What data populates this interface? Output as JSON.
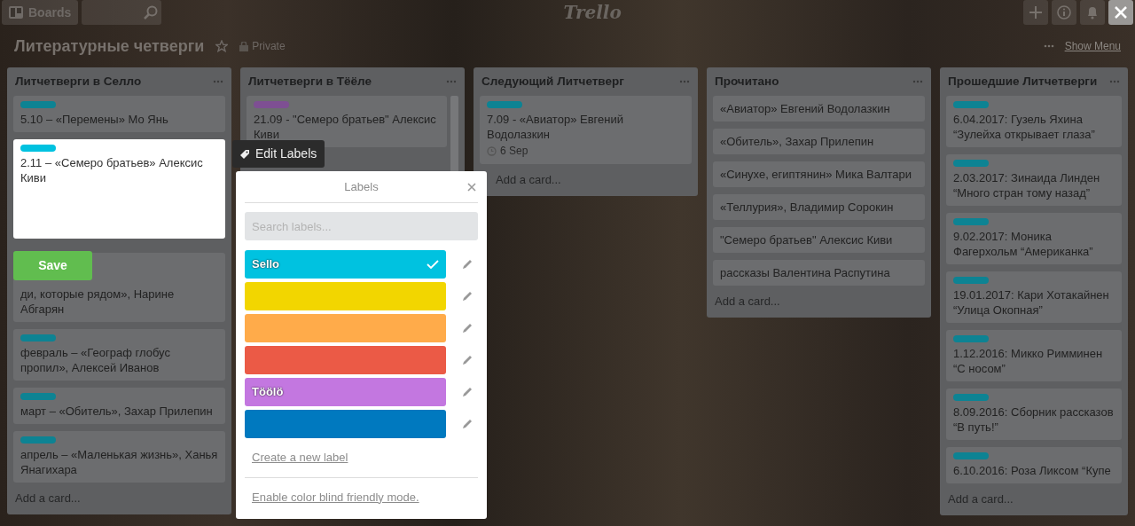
{
  "header": {
    "boards_button": "Boards",
    "logo": "Trello"
  },
  "board": {
    "title": "Литературные четверги",
    "visibility": "Private",
    "show_menu": "Show Menu"
  },
  "lists": [
    {
      "title": "Литчетверги в Селло",
      "cards": [
        {
          "kind": "card",
          "text": "5.10 – «Перемены» Мо Янь",
          "labels": [
            {
              "color": "#0d8393"
            }
          ]
        },
        {
          "kind": "quick_edit",
          "text": "2.11 – «Семеро братьев» Алексис Киви",
          "labels": [
            {
              "color": "#00c2e0"
            }
          ],
          "save": "Save"
        },
        {
          "kind": "covered",
          "text": "ди, которые рядом», Нарине Абгарян"
        },
        {
          "kind": "card",
          "text": "февраль – «Географ глобус пропил», Алексей Иванов",
          "labels": [
            {
              "color": "#0d8393"
            }
          ]
        },
        {
          "kind": "card",
          "text": "март – «Обитель», Захар Прилепин",
          "labels": [
            {
              "color": "#0d8393"
            }
          ]
        },
        {
          "kind": "card",
          "text": "апрель – «Маленькая жизнь», Ханья Янагихара",
          "labels": [
            {
              "color": "#0d8393"
            }
          ]
        }
      ],
      "add_card": "Add a card..."
    },
    {
      "title": "Литчетверги в Тёёле",
      "scrollbar": true,
      "cards": [
        {
          "kind": "card",
          "text": "21.09 - \"Семеро братьев\" Алексис Киви",
          "labels": [
            {
              "color": "#7e4f93"
            }
          ]
        }
      ]
    },
    {
      "title": "Следующий Литчетверг",
      "cards": [
        {
          "kind": "card",
          "text": "7.09 - «Авиатор» Евгений Водолазкин",
          "labels": [
            {
              "color": "#0d8393"
            }
          ],
          "due": "6 Sep"
        }
      ],
      "add_card": "Add a card..."
    },
    {
      "title": "Прочитано",
      "cards": [
        {
          "kind": "card",
          "text": "«Авиатор» Евгений Водолазкин"
        },
        {
          "kind": "card",
          "text": "«Обитель», Захар Прилепин"
        },
        {
          "kind": "card",
          "text": "«Синухе, египтянин» Мика Валтари"
        },
        {
          "kind": "card",
          "text": "«Теллурия», Владимир Сорокин"
        },
        {
          "kind": "card",
          "text": "\"Семеро братьев\" Алексис Киви"
        },
        {
          "kind": "card",
          "text": "рассказы Валентина Распутина"
        }
      ],
      "add_card": "Add a card..."
    },
    {
      "title": "Прошедшие Литчетверги",
      "cards": [
        {
          "kind": "card",
          "text": "6.04.2017: Гузель Яхина “Зулейха открывает глаза”",
          "labels": [
            {
              "color": "#0d8393"
            }
          ]
        },
        {
          "kind": "card",
          "text": "2.03.2017: Зинаида Линден “Много стран тому назад”",
          "labels": [
            {
              "color": "#0d8393"
            }
          ]
        },
        {
          "kind": "card",
          "text": "9.02.2017: Моника Фагерхольм “Американка”",
          "labels": [
            {
              "color": "#0d8393"
            }
          ]
        },
        {
          "kind": "card",
          "text": "19.01.2017: Кари Хотакайнен “Улица Окопная”",
          "labels": [
            {
              "color": "#0d8393"
            }
          ]
        },
        {
          "kind": "card",
          "text": "1.12.2016: Микко Римминен “С носом”",
          "labels": [
            {
              "color": "#0d8393"
            }
          ]
        },
        {
          "kind": "card",
          "text": "8.09.2016: Сборник рассказов “В путь!”",
          "labels": [
            {
              "color": "#0d8393"
            }
          ]
        },
        {
          "kind": "card",
          "text": "6.10.2016: Роза Ликсом “Купе",
          "labels": [
            {
              "color": "#0d8393"
            }
          ]
        }
      ],
      "add_card": "Add a card..."
    }
  ],
  "edit_labels_button": "Edit Labels",
  "labels_popup": {
    "title": "Labels",
    "search_placeholder": "Search labels...",
    "labels": [
      {
        "name": "Sello",
        "color": "#00c2e0",
        "selected": true
      },
      {
        "color": "#f2d600",
        "selected": false
      },
      {
        "color": "#ffab4a",
        "selected": false
      },
      {
        "color": "#eb5a46",
        "selected": false
      },
      {
        "name": "Töölö",
        "color": "#c377e0",
        "selected": false
      },
      {
        "color": "#0079bf",
        "selected": false
      }
    ],
    "create_link": "Create a new label",
    "color_blind_link": "Enable color blind friendly mode."
  }
}
